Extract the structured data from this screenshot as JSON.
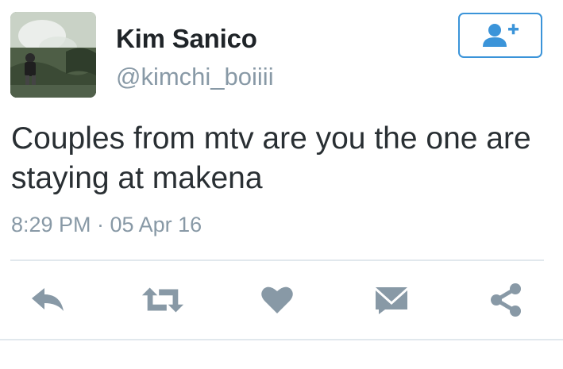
{
  "tweet": {
    "author_name": "Kim Sanico",
    "author_handle": "@kimchi_boiiii",
    "text": "Couples from mtv are you the one are staying at makena",
    "timestamp": "8:29 PM · 05 Apr 16"
  },
  "icons": {
    "follow": "follow-person-plus-icon",
    "reply": "reply-icon",
    "retweet": "retweet-icon",
    "like": "heart-icon",
    "dm": "envelope-icon",
    "share": "share-icon"
  },
  "colors": {
    "accent": "#3b94d9",
    "muted": "#8899a6",
    "text": "#292f33",
    "divider": "#e1e8ed"
  }
}
